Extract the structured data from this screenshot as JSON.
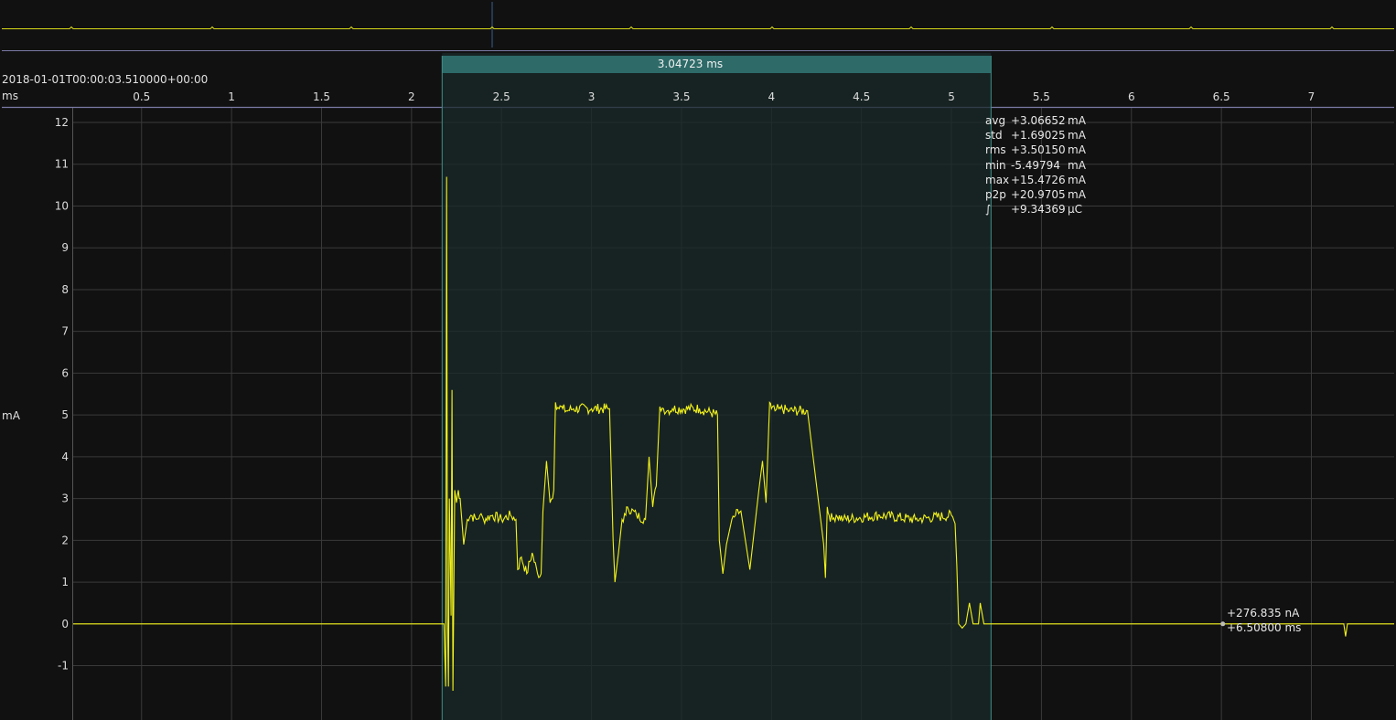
{
  "timestamp": "2018-01-01T00:00:03.510000+00:00",
  "x_unit": "ms",
  "y_unit": "mA",
  "dual_marker": {
    "delta_label": "3.04723 ms",
    "start_ms": 2.17,
    "end_ms": 5.22
  },
  "statistics": [
    {
      "key": "avg",
      "value": "+3.06652",
      "unit": "mA"
    },
    {
      "key": "std",
      "value": "+1.69025",
      "unit": "mA"
    },
    {
      "key": "rms",
      "value": "+3.50150",
      "unit": "mA"
    },
    {
      "key": "min",
      "value": "-5.49794",
      "unit": "mA"
    },
    {
      "key": "max",
      "value": "+15.4726",
      "unit": "mA"
    },
    {
      "key": "p2p",
      "value": "+20.9705",
      "unit": "mA"
    },
    {
      "key": "∫",
      "value": "+9.34369",
      "unit": "µC"
    }
  ],
  "single_marker": {
    "value_label": "+276.835 nA",
    "time_label": "+6.50800 ms",
    "time_ms": 6.508
  },
  "colors": {
    "background": "#111111",
    "trace": "#f2f21a",
    "grid": "#3a3a3a",
    "axis": "#7a7aa6",
    "selection_fill": "#1a2a29",
    "selection_header": "#2d6a68",
    "selection_edge": "#3f8e8a"
  },
  "chart_data": {
    "type": "line",
    "xlabel": "ms",
    "ylabel": "mA",
    "xlim": [
      0.12,
      7.46
    ],
    "ylim": [
      -2.3,
      12.35
    ],
    "x_ticks": [
      "0.5",
      "1",
      "1.5",
      "2",
      "2.5",
      "3",
      "3.5",
      "4",
      "4.5",
      "5",
      "5.5",
      "6",
      "6.5",
      "7"
    ],
    "y_ticks": [
      "-1",
      "0",
      "1",
      "2",
      "3",
      "4",
      "5",
      "6",
      "7",
      "8",
      "9",
      "10",
      "11",
      "12"
    ],
    "grid": true,
    "series": [
      {
        "x": [
          0.12,
          2.18,
          2.19,
          2.195,
          2.2,
          2.205,
          2.21,
          2.22,
          2.225,
          2.23,
          2.24,
          2.25,
          2.26,
          2.27,
          2.29,
          2.31,
          2.33,
          2.36,
          2.38,
          2.4,
          2.45,
          2.5,
          2.55,
          2.58,
          2.59,
          2.61,
          2.64,
          2.67,
          2.7,
          2.72,
          2.73,
          2.75,
          2.77,
          2.79,
          2.8,
          2.82,
          2.83,
          2.84,
          2.86,
          2.9,
          3.0,
          3.1,
          3.12,
          3.13,
          3.15,
          3.17,
          3.19,
          3.2,
          3.25,
          3.3,
          3.32,
          3.34,
          3.36,
          3.38,
          3.4,
          3.42,
          3.45,
          3.6,
          3.7,
          3.71,
          3.73,
          3.75,
          3.78,
          3.8,
          3.83,
          3.88,
          3.93,
          3.95,
          3.97,
          3.99,
          4.0,
          4.02,
          4.04,
          4.05,
          4.1,
          4.2,
          4.29,
          4.3,
          4.31,
          4.32,
          4.34,
          4.36,
          4.4,
          4.6,
          4.8,
          5.0,
          5.02,
          5.03,
          5.04,
          5.06,
          5.08,
          5.1,
          5.12,
          5.14,
          5.15,
          5.16,
          5.18,
          5.19,
          5.2,
          6.508,
          7.18,
          7.19,
          7.2,
          7.46
        ],
        "y": [
          0.0,
          0.0,
          -1.5,
          10.7,
          0.2,
          -1.5,
          3.0,
          0.2,
          5.6,
          -1.6,
          3.2,
          2.9,
          3.2,
          3.0,
          1.9,
          2.5,
          2.6,
          2.5,
          2.6,
          2.5,
          2.6,
          2.5,
          2.6,
          2.5,
          1.3,
          1.6,
          1.2,
          1.7,
          1.2,
          1.2,
          2.7,
          3.9,
          2.9,
          3.2,
          5.3,
          5.15,
          5.2,
          5.15,
          5.1,
          5.15,
          5.15,
          5.15,
          2.0,
          1.0,
          1.7,
          2.5,
          2.6,
          2.8,
          2.6,
          2.5,
          4.0,
          2.8,
          3.3,
          5.2,
          5.15,
          5.1,
          5.15,
          5.15,
          5.0,
          2.0,
          1.2,
          1.9,
          2.5,
          2.6,
          2.7,
          1.3,
          3.2,
          3.9,
          2.9,
          5.3,
          5.15,
          5.1,
          5.15,
          5.15,
          5.1,
          5.1,
          1.9,
          1.1,
          2.8,
          2.6,
          2.5,
          2.6,
          2.5,
          2.6,
          2.5,
          2.6,
          2.4,
          1.4,
          0.0,
          -0.1,
          0.0,
          0.5,
          0.0,
          0.0,
          0.0,
          0.5,
          0.0,
          0.0,
          0.0,
          0.0,
          0.0,
          -0.3,
          0.0,
          0.0
        ]
      }
    ]
  }
}
